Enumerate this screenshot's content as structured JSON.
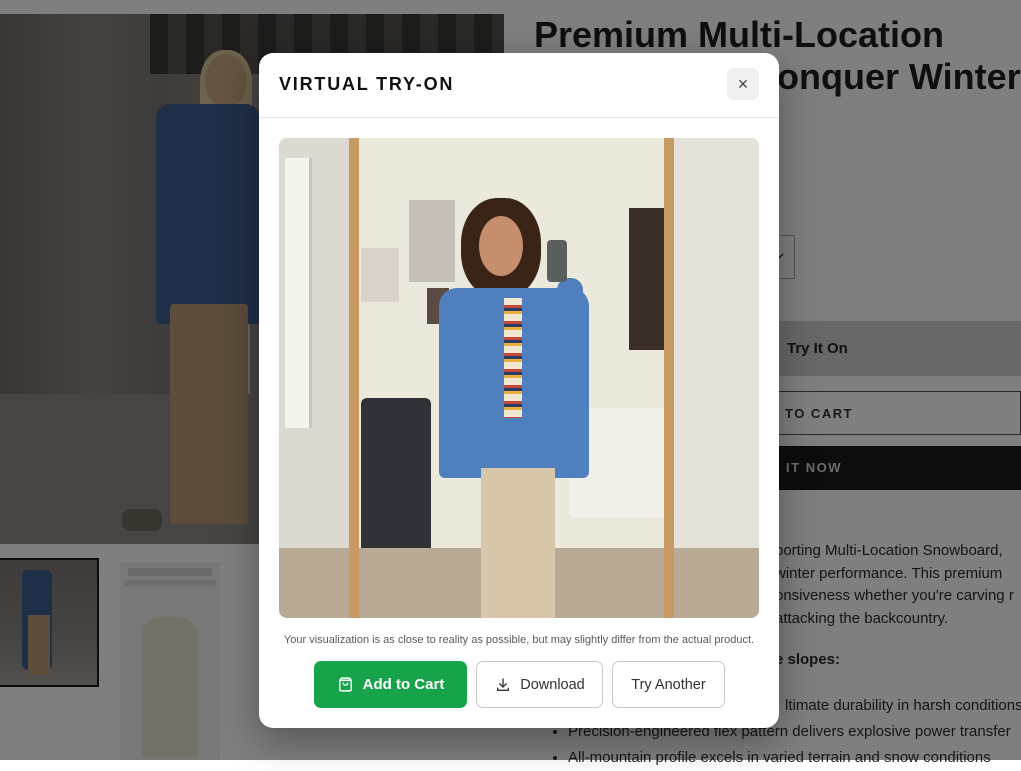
{
  "product": {
    "title_line1": "Premium Multi-Location",
    "title_line2": "onquer Winter",
    "try_it_on_label": "Try It On",
    "add_to_cart_label": "TO CART",
    "buy_now_label": "Y IT NOW",
    "description": "porting Multi-Location Snowboard, winter performance. This premium onsiveness whether you're carving r attacking the backcountry.",
    "features_heading": "e slopes:",
    "features": [
      "ltimate durability in harsh conditions",
      "Precision-engineered flex pattern delivers explosive power transfer",
      "All-mountain profile excels in varied terrain and snow conditions"
    ]
  },
  "modal": {
    "title": "VIRTUAL TRY-ON",
    "close_symbol": "×",
    "disclaimer": "Your visualization is as close to reality as possible, but may slightly differ from the actual product.",
    "actions": {
      "add_to_cart": "Add to Cart",
      "download": "Download",
      "try_another": "Try Another"
    },
    "primary_color": "#16a34a"
  },
  "icons": {
    "close": "close-icon",
    "cart": "shopping-bag-icon",
    "download": "download-icon",
    "dropdown": "chevron-down-icon"
  }
}
